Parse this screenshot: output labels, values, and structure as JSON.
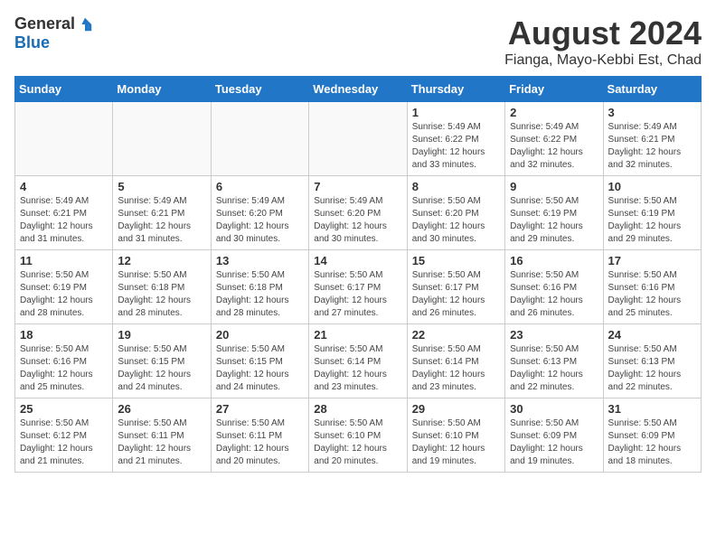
{
  "header": {
    "logo_general": "General",
    "logo_blue": "Blue",
    "month_year": "August 2024",
    "location": "Fianga, Mayo-Kebbi Est, Chad"
  },
  "weekdays": [
    "Sunday",
    "Monday",
    "Tuesday",
    "Wednesday",
    "Thursday",
    "Friday",
    "Saturday"
  ],
  "weeks": [
    [
      {
        "day": "",
        "text": ""
      },
      {
        "day": "",
        "text": ""
      },
      {
        "day": "",
        "text": ""
      },
      {
        "day": "",
        "text": ""
      },
      {
        "day": "1",
        "text": "Sunrise: 5:49 AM\nSunset: 6:22 PM\nDaylight: 12 hours\nand 33 minutes."
      },
      {
        "day": "2",
        "text": "Sunrise: 5:49 AM\nSunset: 6:22 PM\nDaylight: 12 hours\nand 32 minutes."
      },
      {
        "day": "3",
        "text": "Sunrise: 5:49 AM\nSunset: 6:21 PM\nDaylight: 12 hours\nand 32 minutes."
      }
    ],
    [
      {
        "day": "4",
        "text": "Sunrise: 5:49 AM\nSunset: 6:21 PM\nDaylight: 12 hours\nand 31 minutes."
      },
      {
        "day": "5",
        "text": "Sunrise: 5:49 AM\nSunset: 6:21 PM\nDaylight: 12 hours\nand 31 minutes."
      },
      {
        "day": "6",
        "text": "Sunrise: 5:49 AM\nSunset: 6:20 PM\nDaylight: 12 hours\nand 30 minutes."
      },
      {
        "day": "7",
        "text": "Sunrise: 5:49 AM\nSunset: 6:20 PM\nDaylight: 12 hours\nand 30 minutes."
      },
      {
        "day": "8",
        "text": "Sunrise: 5:50 AM\nSunset: 6:20 PM\nDaylight: 12 hours\nand 30 minutes."
      },
      {
        "day": "9",
        "text": "Sunrise: 5:50 AM\nSunset: 6:19 PM\nDaylight: 12 hours\nand 29 minutes."
      },
      {
        "day": "10",
        "text": "Sunrise: 5:50 AM\nSunset: 6:19 PM\nDaylight: 12 hours\nand 29 minutes."
      }
    ],
    [
      {
        "day": "11",
        "text": "Sunrise: 5:50 AM\nSunset: 6:19 PM\nDaylight: 12 hours\nand 28 minutes."
      },
      {
        "day": "12",
        "text": "Sunrise: 5:50 AM\nSunset: 6:18 PM\nDaylight: 12 hours\nand 28 minutes."
      },
      {
        "day": "13",
        "text": "Sunrise: 5:50 AM\nSunset: 6:18 PM\nDaylight: 12 hours\nand 28 minutes."
      },
      {
        "day": "14",
        "text": "Sunrise: 5:50 AM\nSunset: 6:17 PM\nDaylight: 12 hours\nand 27 minutes."
      },
      {
        "day": "15",
        "text": "Sunrise: 5:50 AM\nSunset: 6:17 PM\nDaylight: 12 hours\nand 26 minutes."
      },
      {
        "day": "16",
        "text": "Sunrise: 5:50 AM\nSunset: 6:16 PM\nDaylight: 12 hours\nand 26 minutes."
      },
      {
        "day": "17",
        "text": "Sunrise: 5:50 AM\nSunset: 6:16 PM\nDaylight: 12 hours\nand 25 minutes."
      }
    ],
    [
      {
        "day": "18",
        "text": "Sunrise: 5:50 AM\nSunset: 6:16 PM\nDaylight: 12 hours\nand 25 minutes."
      },
      {
        "day": "19",
        "text": "Sunrise: 5:50 AM\nSunset: 6:15 PM\nDaylight: 12 hours\nand 24 minutes."
      },
      {
        "day": "20",
        "text": "Sunrise: 5:50 AM\nSunset: 6:15 PM\nDaylight: 12 hours\nand 24 minutes."
      },
      {
        "day": "21",
        "text": "Sunrise: 5:50 AM\nSunset: 6:14 PM\nDaylight: 12 hours\nand 23 minutes."
      },
      {
        "day": "22",
        "text": "Sunrise: 5:50 AM\nSunset: 6:14 PM\nDaylight: 12 hours\nand 23 minutes."
      },
      {
        "day": "23",
        "text": "Sunrise: 5:50 AM\nSunset: 6:13 PM\nDaylight: 12 hours\nand 22 minutes."
      },
      {
        "day": "24",
        "text": "Sunrise: 5:50 AM\nSunset: 6:13 PM\nDaylight: 12 hours\nand 22 minutes."
      }
    ],
    [
      {
        "day": "25",
        "text": "Sunrise: 5:50 AM\nSunset: 6:12 PM\nDaylight: 12 hours\nand 21 minutes."
      },
      {
        "day": "26",
        "text": "Sunrise: 5:50 AM\nSunset: 6:11 PM\nDaylight: 12 hours\nand 21 minutes."
      },
      {
        "day": "27",
        "text": "Sunrise: 5:50 AM\nSunset: 6:11 PM\nDaylight: 12 hours\nand 20 minutes."
      },
      {
        "day": "28",
        "text": "Sunrise: 5:50 AM\nSunset: 6:10 PM\nDaylight: 12 hours\nand 20 minutes."
      },
      {
        "day": "29",
        "text": "Sunrise: 5:50 AM\nSunset: 6:10 PM\nDaylight: 12 hours\nand 19 minutes."
      },
      {
        "day": "30",
        "text": "Sunrise: 5:50 AM\nSunset: 6:09 PM\nDaylight: 12 hours\nand 19 minutes."
      },
      {
        "day": "31",
        "text": "Sunrise: 5:50 AM\nSunset: 6:09 PM\nDaylight: 12 hours\nand 18 minutes."
      }
    ]
  ]
}
